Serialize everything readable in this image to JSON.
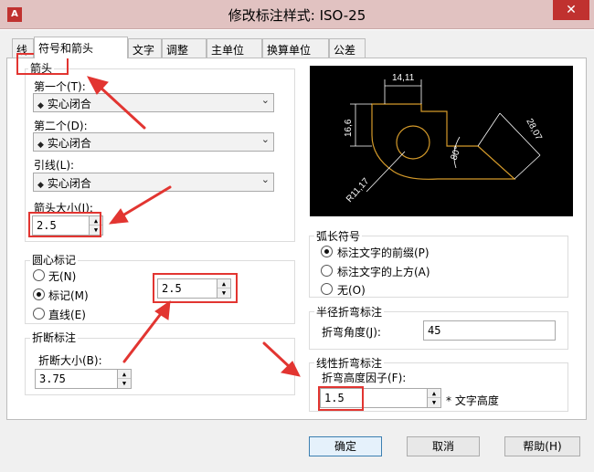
{
  "window": {
    "title": "修改标注样式: ISO-25",
    "close": "✕",
    "icon": "A"
  },
  "tabs": [
    "线",
    "符号和箭头",
    "文字",
    "调整",
    "主单位",
    "换算单位",
    "公差"
  ],
  "arrows": {
    "group_label": "箭头",
    "first_label": "第一个(T):",
    "first_value": "实心闭合",
    "second_label": "第二个(D):",
    "second_value": "实心闭合",
    "leader_label": "引线(L):",
    "leader_value": "实心闭合",
    "size_label": "箭头大小(I):",
    "size_value": "2.5"
  },
  "center_marks": {
    "group_label": "圆心标记",
    "none_label": "无(N)",
    "mark_label": "标记(M)",
    "line_label": "直线(E)",
    "selected": "mark",
    "size_value": "2.5"
  },
  "break": {
    "group_label": "折断标注",
    "size_label": "折断大小(B):",
    "size_value": "3.75"
  },
  "preview": {
    "dim_top": "14,11",
    "dim_left": "16,6",
    "dim_right": "28,07",
    "angle": "80°",
    "radius": "R11,17"
  },
  "arc_length": {
    "group_label": "弧长符号",
    "option_before": "标注文字的前缀(P)",
    "option_above": "标注文字的上方(A)",
    "option_none": "无(O)",
    "selected": "before"
  },
  "radius_jog": {
    "group_label": "半径折弯标注",
    "angle_label": "折弯角度(J):",
    "angle_value": "45"
  },
  "linear_jog": {
    "group_label": "线性折弯标注",
    "factor_label": "折弯高度因子(F):",
    "factor_value": "1.5",
    "suffix": "* 文字高度"
  },
  "buttons": {
    "ok": "确定",
    "cancel": "取消",
    "help": "帮助(H)"
  },
  "colors": {
    "annotation_red": "#e23531",
    "preview_bg": "#000000",
    "preview_shape": "#d49a2a"
  }
}
